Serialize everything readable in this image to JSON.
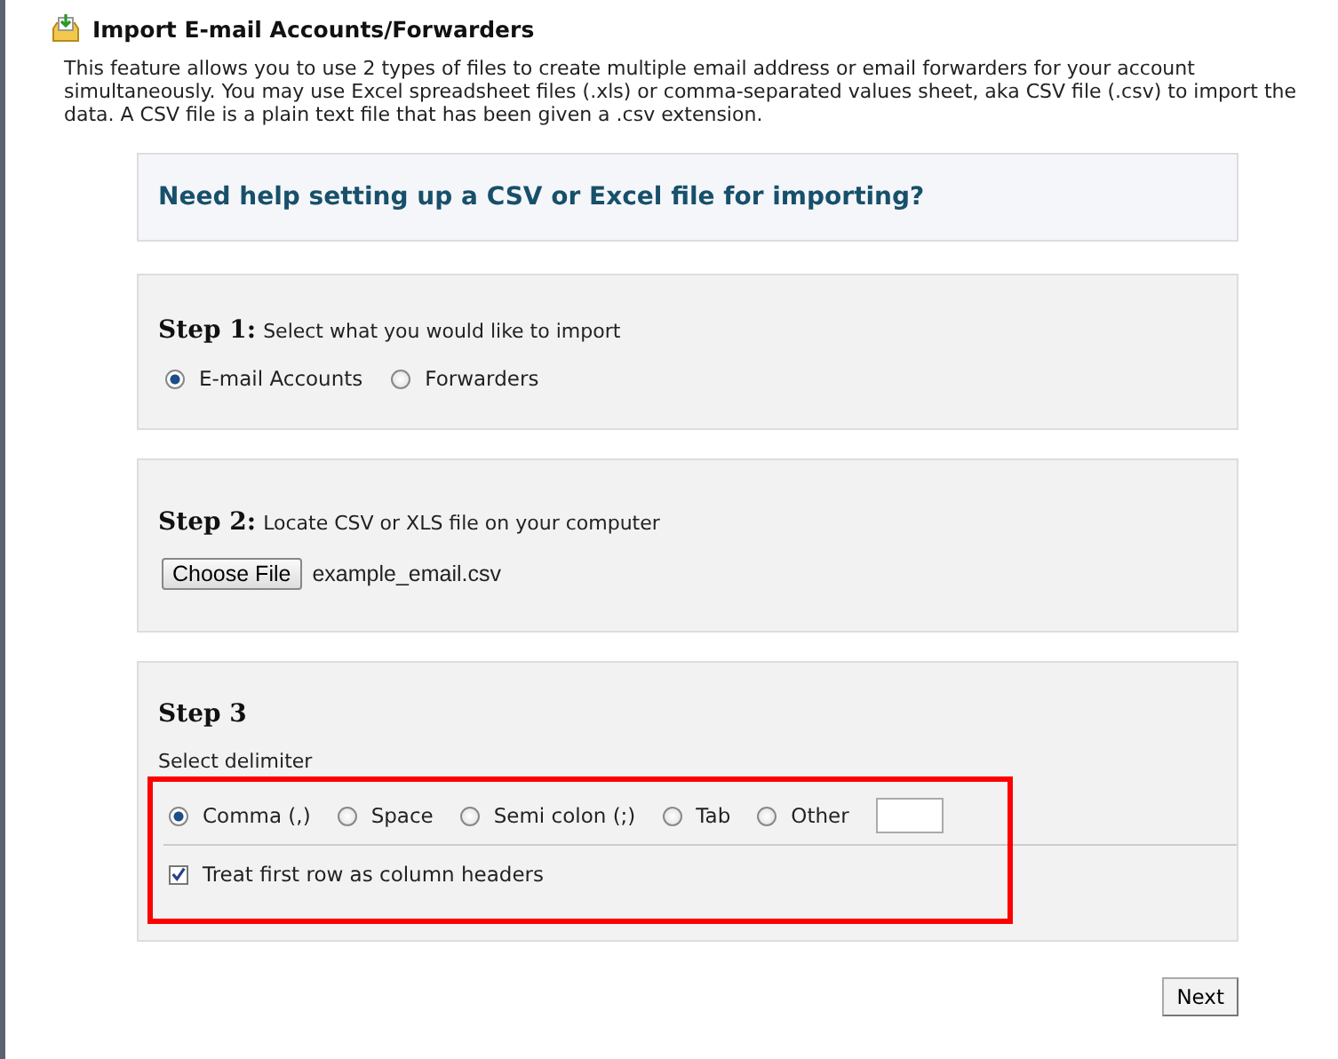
{
  "title": "Import E-mail Accounts/Forwarders",
  "intro": "This feature allows you to use 2 types of files to create multiple email address or email forwarders for your account simultaneously. You may use Excel spreadsheet files (.xls) or comma-separated values sheet, aka CSV file (.csv) to import the data. A CSV file is a plain text file that has been given a .csv extension.",
  "help": "Need help setting up a CSV or Excel file for importing?",
  "step1": {
    "heading": "Step 1:",
    "text": "Select what you would like to import",
    "options": [
      {
        "label": "E-mail Accounts",
        "selected": true
      },
      {
        "label": "Forwarders",
        "selected": false
      }
    ]
  },
  "step2": {
    "heading": "Step 2:",
    "text": "Locate CSV or XLS file on your computer",
    "button": "Choose File",
    "file": "example_email.csv"
  },
  "step3": {
    "heading": "Step 3",
    "text": "Select delimiter",
    "delimiters": [
      {
        "label": "Comma (,)",
        "selected": true
      },
      {
        "label": "Space",
        "selected": false
      },
      {
        "label": "Semi colon (;)",
        "selected": false
      },
      {
        "label": "Tab",
        "selected": false
      },
      {
        "label": "Other",
        "selected": false
      }
    ],
    "header_row": {
      "label": "Treat first row as column headers",
      "checked": true
    }
  },
  "next": "Next"
}
